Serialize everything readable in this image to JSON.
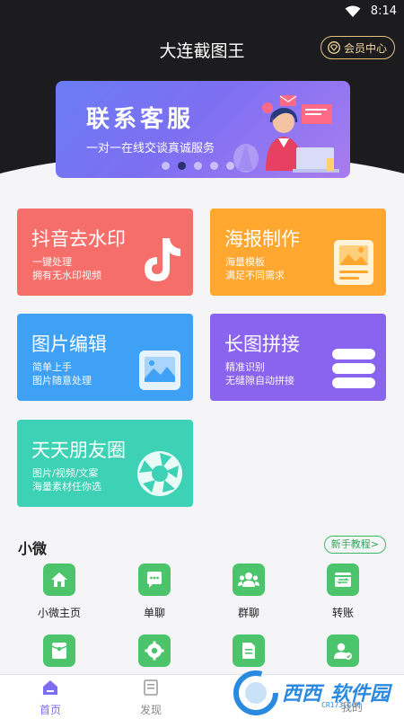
{
  "status_bar": {
    "time": "8:14"
  },
  "header": {
    "title": "大连截图王",
    "vip_label": "会员中心"
  },
  "banner": {
    "title": "联系客服",
    "subtitle": "一对一在线交谈真诚服务",
    "dot_count": 5,
    "active_dot": 1
  },
  "cards": [
    {
      "title": "抖音去水印",
      "desc1": "一键处理",
      "desc2": "拥有无水印视频",
      "color": "#f66e6a",
      "icon": "tiktok-icon"
    },
    {
      "title": "海报制作",
      "desc1": "海量模板",
      "desc2": "满足不同需求",
      "color": "#ffa72f",
      "icon": "poster-icon"
    },
    {
      "title": "图片编辑",
      "desc1": "简单上手",
      "desc2": "图片随意处理",
      "color": "#3fa1f5",
      "icon": "image-icon"
    },
    {
      "title": "长图拼接",
      "desc1": "精准识别",
      "desc2": "无缝隙自动拼接",
      "color": "#8a63ef",
      "icon": "stack-icon"
    },
    {
      "title": "天天朋友圈",
      "desc1": "图片/视频/文案",
      "desc2": "海量素材任你选",
      "color": "#3dd1b5",
      "icon": "aperture-icon"
    }
  ],
  "section": {
    "title": "小微",
    "guide_label": "新手教程>"
  },
  "tools": [
    {
      "label": "小微主页",
      "icon": "home-icon"
    },
    {
      "label": "单聊",
      "icon": "chat-icon"
    },
    {
      "label": "群聊",
      "icon": "group-icon"
    },
    {
      "label": "转账",
      "icon": "transfer-icon"
    },
    {
      "label": "",
      "icon": "redpacket-icon"
    },
    {
      "label": "",
      "icon": "settings-icon"
    },
    {
      "label": "",
      "icon": "document-icon"
    },
    {
      "label": "",
      "icon": "user-icon"
    }
  ],
  "tabs": [
    {
      "label": "首页",
      "active": true
    },
    {
      "label": "发现",
      "active": false
    },
    {
      "label": "",
      "active": false
    },
    {
      "label": "我的",
      "active": false
    }
  ],
  "watermark": {
    "text1": "西西",
    "text2": "软件园",
    "small": "CR173.COM"
  },
  "colors": {
    "accent": "#7b6cf0",
    "tool_green": "#4cc46c",
    "header_bg": "#1c1c1e"
  }
}
